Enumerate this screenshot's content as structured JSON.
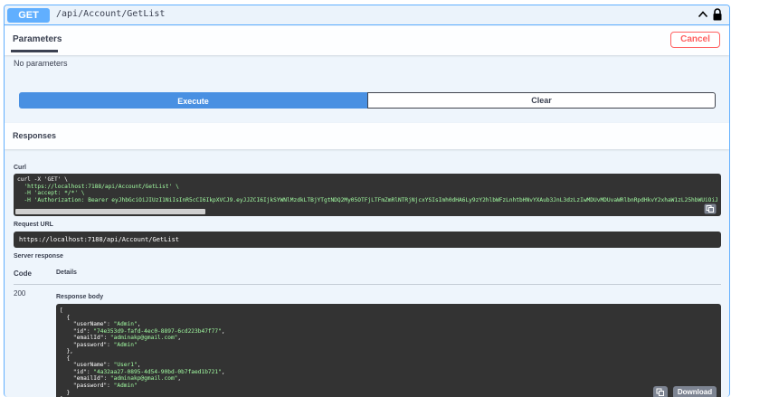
{
  "operation": {
    "method": "GET",
    "path": "/api/Account/GetList"
  },
  "parameters": {
    "tab_label": "Parameters",
    "cancel_label": "Cancel",
    "empty_text": "No parameters"
  },
  "actions": {
    "execute_label": "Execute",
    "clear_label": "Clear"
  },
  "responses": {
    "title": "Responses",
    "curl_label": "Curl",
    "curl_lines": [
      "curl -X 'GET' \\",
      "  'https://localhost:7188/api/Account/GetList' \\",
      "  -H 'accept: */*' \\",
      "  -H 'Authorization: Bearer eyJhbGciOiJIUzI1NiIsInR5cCI6IkpXVCJ9.eyJJZCI6IjkSYWNlMzdkLTBjYTgtNDQ2My05OTFjLTFmZmRlNTRjNjcxYSIsImh0dHA6Ly9zY2hlbWFzLnhtbHNvYXAub3JnL3dzLzIwMDUvMDUvaWRlbnRpdHkvY2xhaW1zL25hbWUiOiJ"
    ],
    "request_url_label": "Request URL",
    "request_url": "https://localhost:7188/api/Account/GetList",
    "server_response_label": "Server response",
    "code_header": "Code",
    "details_header": "Details",
    "status_code": "200",
    "response_body_label": "Response body",
    "download_label": "Download",
    "body": [
      {
        "userName": "Admin",
        "id": "74e353d9-fafd-4ec0-8897-6cd223b47f77",
        "emailId": "adminakp@gmail.com",
        "password": "Admin"
      },
      {
        "userName": "User1",
        "id": "4a32aa27-0895-4d54-90bd-0b7faed1b721",
        "emailId": "adminakp@gmail.com",
        "password": "Admin"
      }
    ]
  },
  "colors": {
    "get_blue": "#61affe",
    "execute_blue": "#4990e2",
    "cancel_red": "#ff6060",
    "code_bg": "#333333",
    "string_green": "#a2fca2"
  },
  "icons": [
    "chevron-up-icon",
    "lock-icon",
    "copy-icon"
  ]
}
